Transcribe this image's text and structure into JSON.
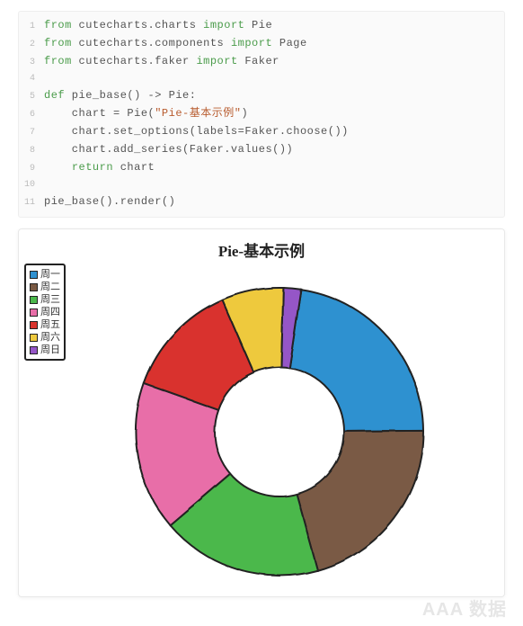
{
  "code": {
    "lines": [
      "from cutecharts.charts import Pie",
      "from cutecharts.components import Page",
      "from cutecharts.faker import Faker",
      "",
      "def pie_base() -> Pie:",
      "    chart = Pie(\"Pie-基本示例\")",
      "    chart.set_options(labels=Faker.choose())",
      "    chart.add_series(Faker.values())",
      "    return chart",
      "",
      "pie_base().render()"
    ]
  },
  "chart_data": {
    "type": "pie",
    "title": "Pie-基本示例",
    "categories": [
      "周一",
      "周二",
      "周三",
      "周四",
      "周五",
      "周六",
      "周日"
    ],
    "values": [
      81,
      75,
      65,
      60,
      47,
      25,
      7
    ],
    "colors": [
      "#2f91d0",
      "#7a5a44",
      "#4bb84b",
      "#e86ea8",
      "#d9332d",
      "#eec93e",
      "#9556c7"
    ],
    "inner_radius_ratio": 0.45,
    "legend_position": "top-left"
  },
  "watermark": "AAA 数据"
}
